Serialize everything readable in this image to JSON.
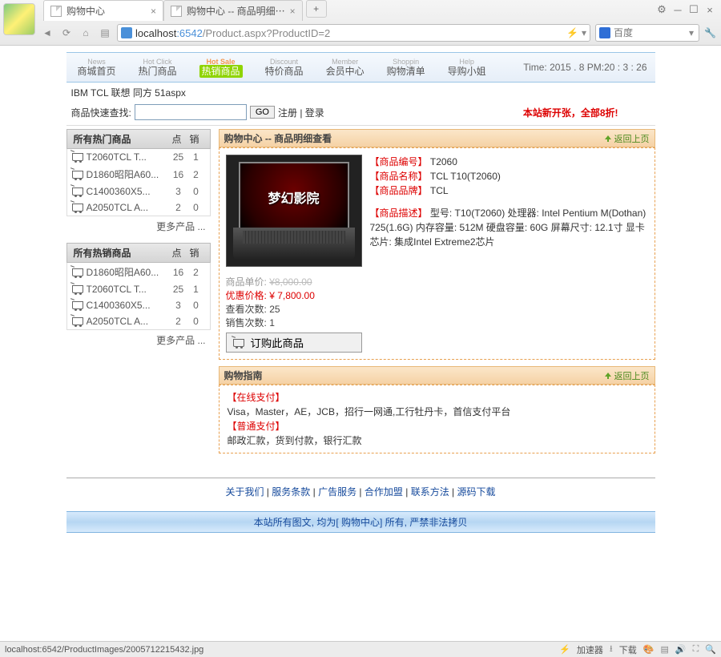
{
  "browser": {
    "tabs": [
      {
        "title": "购物中心"
      },
      {
        "title": "购物中心 -- 商品明细⋯"
      }
    ],
    "url_host": "localhost",
    "url_port": ":6542",
    "url_path": "/Product.aspx?ProductID=2",
    "search_engine": "百度",
    "status_url": "localhost:6542/ProductImages/2005712215432.jpg",
    "status_accel": "加速器",
    "status_download": "下载"
  },
  "nav": {
    "items": [
      {
        "en": "News",
        "cn": "商城首页"
      },
      {
        "en": "Hot Click",
        "cn": "热门商品"
      },
      {
        "en": "Hot Sale",
        "cn": "热销商品"
      },
      {
        "en": "Discount",
        "cn": "特价商品"
      },
      {
        "en": "Member",
        "cn": "会员中心"
      },
      {
        "en": "Shoppin",
        "cn": "购物清单"
      },
      {
        "en": "Help",
        "cn": "导购小姐"
      }
    ],
    "active_index": 2,
    "time": "Time:  2015 . 8  PM:20  :  3  :  26"
  },
  "keywords": "IBM TCL 联想 同方 51aspx",
  "quicksearch": {
    "label": "商品快速查找:",
    "value": "",
    "go": "GO",
    "register": "注册",
    "login": "登录",
    "promo": "本站新开张，全部8折!"
  },
  "side_hot": {
    "title": "所有热门商品",
    "col1": "点",
    "col2": "销",
    "more": "更多产品 ...",
    "items": [
      {
        "name": "T2060TCL T...",
        "c1": "25",
        "c2": "1"
      },
      {
        "name": "D1860昭阳A60...",
        "c1": "16",
        "c2": "2"
      },
      {
        "name": "C1400360X5...",
        "c1": "3",
        "c2": "0"
      },
      {
        "name": "A2050TCL A...",
        "c1": "2",
        "c2": "0"
      }
    ]
  },
  "side_sale": {
    "title": "所有热销商品",
    "col1": "点",
    "col2": "销",
    "more": "更多产品 ...",
    "items": [
      {
        "name": "D1860昭阳A60...",
        "c1": "16",
        "c2": "2"
      },
      {
        "name": "T2060TCL T...",
        "c1": "25",
        "c2": "1"
      },
      {
        "name": "C1400360X5...",
        "c1": "3",
        "c2": "0"
      },
      {
        "name": "A2050TCL A...",
        "c1": "2",
        "c2": "0"
      }
    ]
  },
  "detail": {
    "header": "购物中心 -- 商品明细查看",
    "back": "返回上页",
    "labels": {
      "id": "【商品编号】",
      "name": "【商品名称】",
      "brand": "【商品品牌】",
      "desc": "【商品描述】",
      "unit_price": "商品单价:",
      "promo_price": "优惠价格:",
      "views": "查看次数:",
      "sales": "销售次数:"
    },
    "values": {
      "id": "T2060",
      "name": "TCL T10(T2060)",
      "brand": "TCL",
      "desc": "型号: T10(T2060) 处理器: Intel Pentium M(Dothan) 725(1.6G) 内存容量: 512M 硬盘容量: 60G 屏幕尺寸: 12.1寸 显卡芯片: 集成Intel Extreme2芯片",
      "unit_price": "¥8,000.00",
      "promo_price": "¥ 7,800.00",
      "views": "25",
      "sales": "1"
    },
    "order_btn": "订购此商品",
    "screen_text": "梦幻影院"
  },
  "guide": {
    "header": "购物指南",
    "back": "返回上页",
    "online_label": "【在线支付】",
    "online_text": "Visa，Master，AE，JCB，招行一网通,工行牡丹卡，首信支付平台",
    "normal_label": "【普通支付】",
    "normal_text": "邮政汇款，货到付款，银行汇款"
  },
  "footer": {
    "links": [
      "关于我们",
      "服务条款",
      "广告服务",
      "合作加盟",
      "联系方法",
      "源码下载"
    ],
    "sep": " | ",
    "banner": "本站所有图文, 均为[ 购物中心] 所有, 严禁非法拷贝"
  }
}
